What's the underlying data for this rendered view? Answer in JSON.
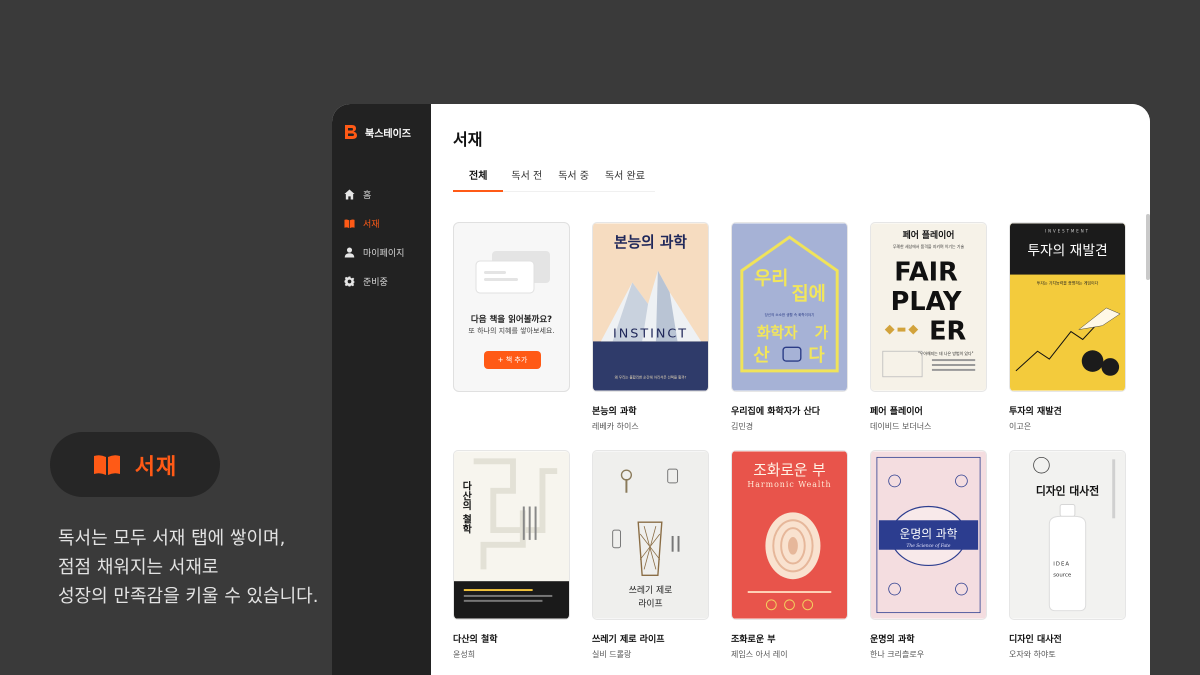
{
  "promo": {
    "label": "서재",
    "description": [
      "독서는 모두 서재 탭에 쌓이며,",
      "점점 채워지는 서재로",
      "성장의 만족감을 키울 수 있습니다."
    ],
    "icon": "open-book-icon",
    "accent": "#ff5a16"
  },
  "app": {
    "brand": "북스테이즈",
    "nav": [
      {
        "label": "홈",
        "icon": "home-icon"
      },
      {
        "label": "서재",
        "icon": "open-book-icon",
        "active": true
      },
      {
        "label": "마이페이지",
        "icon": "person-icon"
      },
      {
        "label": "준비중",
        "icon": "gear-icon"
      }
    ],
    "page_title": "서재",
    "tabs": [
      "전체",
      "독서 전",
      "독서 중",
      "독서 완료"
    ],
    "add_card": {
      "title": "다음 책을 읽어볼까요?",
      "subtitle": "또 하나의 지혜를 쌓아보세요.",
      "button": "+ 책 추가"
    },
    "books": [
      {
        "title": "본능의 과학",
        "author": "레베카 하이스",
        "cover": {
          "heading": "본능의 과학",
          "word": "INSTINCT",
          "caption": "왜 우리는 불합리한 순간에 아리석은 선택을 할까?"
        }
      },
      {
        "title": "우리집에 화학자가 산다",
        "author": "김민경",
        "cover": {
          "line1": "우리",
          "line2": "집에",
          "line3": "화학자",
          "line4": "가",
          "line5": "산",
          "line6": "다",
          "sub": "당신의 소소한 생활 속 화학이야기"
        }
      },
      {
        "title": "페어 플레이어",
        "author": "데이비드 보더너스",
        "cover": {
          "heading": "페어 플레이어",
          "sub": "무례한 세상에서 품격을 지키며 이기는 기술",
          "big1": "FAIR",
          "big2": "PLAY",
          "big3": "ER",
          "quote": "\"우아해지는 데 나은 방법이 있다\""
        }
      },
      {
        "title": "투자의 재발견",
        "author": "이고은",
        "cover": {
          "tag": "INVESTMENT",
          "heading": "투자의 재발견",
          "sub": "투자는 가치능력을 증명하는 게임이다"
        }
      },
      {
        "title": "다산의 철학",
        "author": "윤성희",
        "cover": {
          "heading": "다산의 철학"
        }
      },
      {
        "title": "쓰레기 제로 라이프",
        "author": "실비 드롤랑",
        "cover": {
          "line1": "쓰레기 제로",
          "line2": "라이프"
        }
      },
      {
        "title": "조화로운 부",
        "author": "제임스 아서 레이",
        "cover": {
          "heading": "조화로운 부",
          "en": "Harmonic Wealth"
        }
      },
      {
        "title": "운명의 과학",
        "author": "한나 크리츨로우",
        "cover": {
          "heading": "운명의 과학",
          "en": "The Science of Fate"
        }
      },
      {
        "title": "디자인 대사전",
        "author": "오자와 하야토",
        "cover": {
          "heading": "디자인 대사전",
          "bottle1": "IDEA",
          "bottle2": "source"
        }
      }
    ]
  }
}
